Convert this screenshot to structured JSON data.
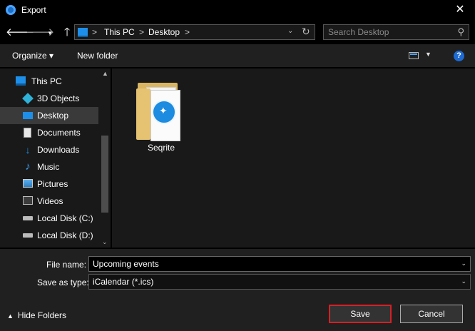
{
  "window": {
    "title": "Export",
    "close_glyph": "✕"
  },
  "nav": {
    "back_glyph": "🡐",
    "forward_glyph": "🡒",
    "recent_glyph": "▾",
    "up_glyph": "🡑"
  },
  "address": {
    "path": [
      "This PC",
      "Desktop"
    ],
    "separator": ">",
    "dropdown_glyph": "⌄",
    "refresh_glyph": "↻"
  },
  "search": {
    "placeholder": "Search Desktop",
    "icon_glyph": "⚲"
  },
  "toolbar": {
    "organize": "Organize ▾",
    "new_folder": "New folder",
    "view_dd": "▼",
    "help": "?"
  },
  "sidebar": {
    "items": [
      {
        "label": "This PC",
        "icon": "pc-icon"
      },
      {
        "label": "3D Objects",
        "icon": "cube-icon"
      },
      {
        "label": "Desktop",
        "icon": "desktop-icon",
        "selected": true
      },
      {
        "label": "Documents",
        "icon": "documents-icon"
      },
      {
        "label": "Downloads",
        "icon": "download-icon"
      },
      {
        "label": "Music",
        "icon": "music-icon"
      },
      {
        "label": "Pictures",
        "icon": "pictures-icon"
      },
      {
        "label": "Videos",
        "icon": "videos-icon"
      },
      {
        "label": "Local Disk (C:)",
        "icon": "drive-icon"
      },
      {
        "label": "Local Disk (D:)",
        "icon": "drive-icon"
      }
    ],
    "scroll_up": "▲",
    "scroll_down": "⌄"
  },
  "content": {
    "items": [
      {
        "label": "Seqrite",
        "icon": "folder-icon"
      }
    ]
  },
  "form": {
    "file_name_label": "File name:",
    "file_name_value": "Upcoming events",
    "type_label": "Save as type:",
    "type_value": "iCalendar (*.ics)",
    "dropdown_glyph": "⌄"
  },
  "footer": {
    "hide_folders": "Hide Folders",
    "hide_chevron": "▲",
    "save": "Save",
    "cancel": "Cancel"
  },
  "colors": {
    "accent": "#1e8fe8",
    "save_border": "#d61f26"
  }
}
